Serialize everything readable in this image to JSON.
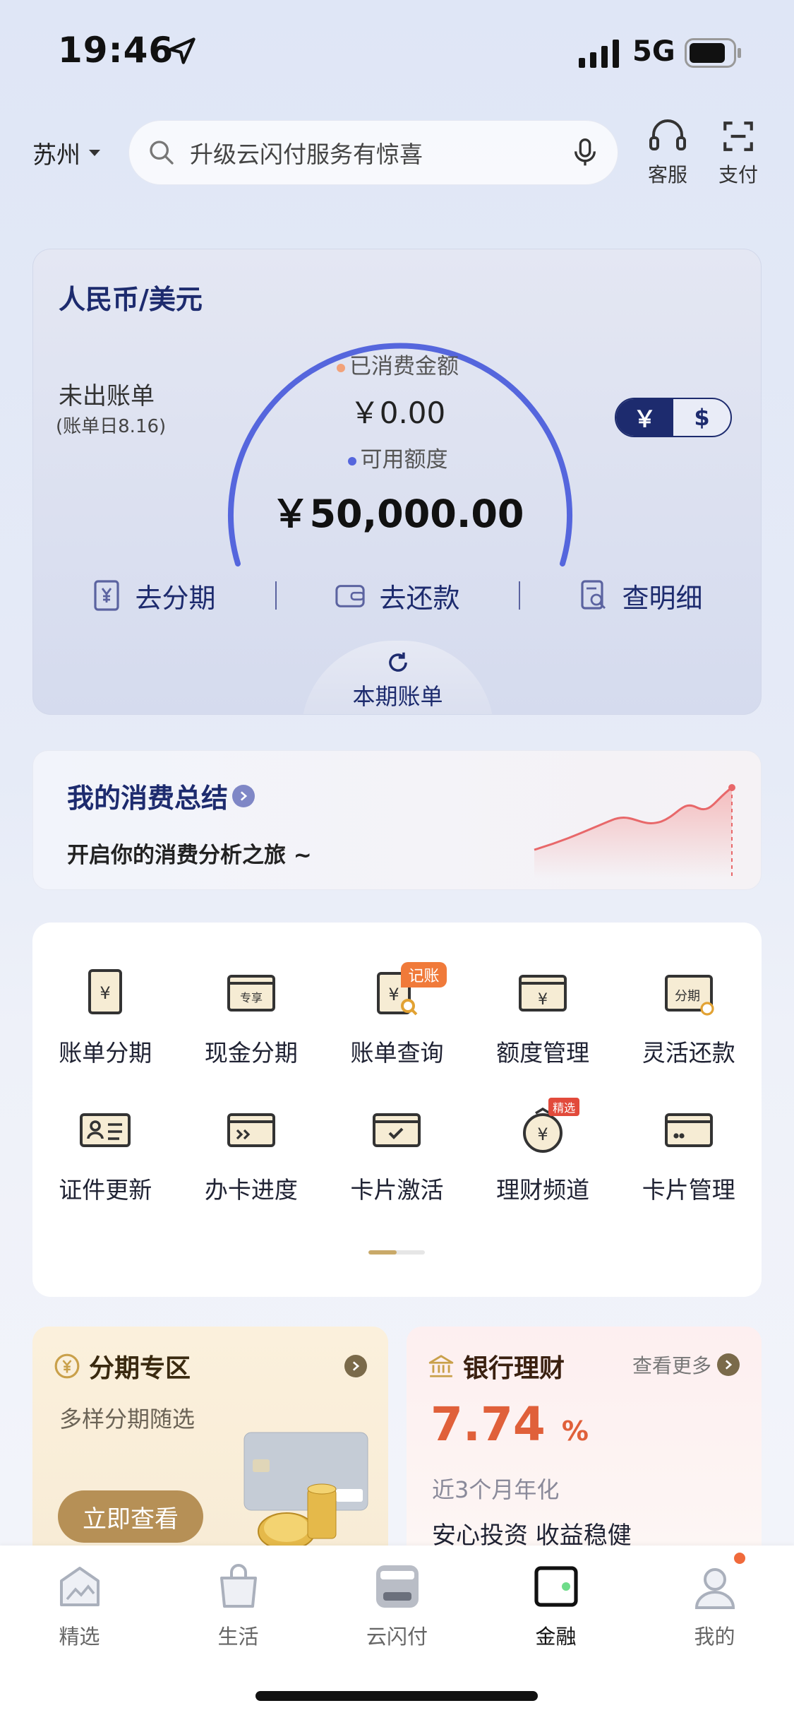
{
  "status_bar": {
    "time": "19:46",
    "network": "5G"
  },
  "header": {
    "city": "苏州",
    "search_placeholder": "升级云闪付服务有惊喜",
    "service_label": "客服",
    "pay_label": "支付"
  },
  "credit_panel": {
    "title": "人民币/美元",
    "unbilled_label": "未出账单",
    "bill_day": "(账单日8.16)",
    "consumed_label": "已消费金额",
    "consumed_value": "￥0.00",
    "available_label": "可用额度",
    "available_value": "￥50,000.00",
    "currency_on": "￥",
    "currency_off": "$",
    "actions": [
      "去分期",
      "去还款",
      "查明细"
    ],
    "current_bill_label": "本期账单",
    "colors": {
      "accent": "#1d2b6e",
      "gauge": "#5566dd",
      "consumed_dot": "#f2a27a",
      "available_dot": "#5566dd"
    }
  },
  "summary": {
    "title": "我的消费总结",
    "subtitle": "开启你的消费分析之旅 ~"
  },
  "services": {
    "items": [
      {
        "label": "账单分期",
        "icon": "bill-installment-icon"
      },
      {
        "label": "现金分期",
        "icon": "cash-installment-icon",
        "badge_text": "专享"
      },
      {
        "label": "账单查询",
        "icon": "bill-query-icon",
        "tag": "记账"
      },
      {
        "label": "额度管理",
        "icon": "limit-management-icon"
      },
      {
        "label": "灵活还款",
        "icon": "flexible-repay-icon",
        "badge_text": "分期"
      },
      {
        "label": "证件更新",
        "icon": "id-update-icon"
      },
      {
        "label": "办卡进度",
        "icon": "card-progress-icon"
      },
      {
        "label": "卡片激活",
        "icon": "card-activate-icon"
      },
      {
        "label": "理财频道",
        "icon": "wealth-channel-icon",
        "tag": "精选"
      },
      {
        "label": "卡片管理",
        "icon": "card-management-icon"
      }
    ]
  },
  "promo_installment": {
    "title": "分期专区",
    "subtitle": "多样分期随选",
    "button": "立即查看"
  },
  "promo_wealth": {
    "title": "银行理财",
    "more": "查看更多",
    "rate": "7.74",
    "rate_unit": "%",
    "period": "近3个月年化",
    "slogan": "安心投资 收益稳健",
    "colors": {
      "rate": "#e0603a"
    }
  },
  "tabbar": {
    "tabs": [
      "精选",
      "生活",
      "云闪付",
      "金融",
      "我的"
    ],
    "active": "金融"
  }
}
